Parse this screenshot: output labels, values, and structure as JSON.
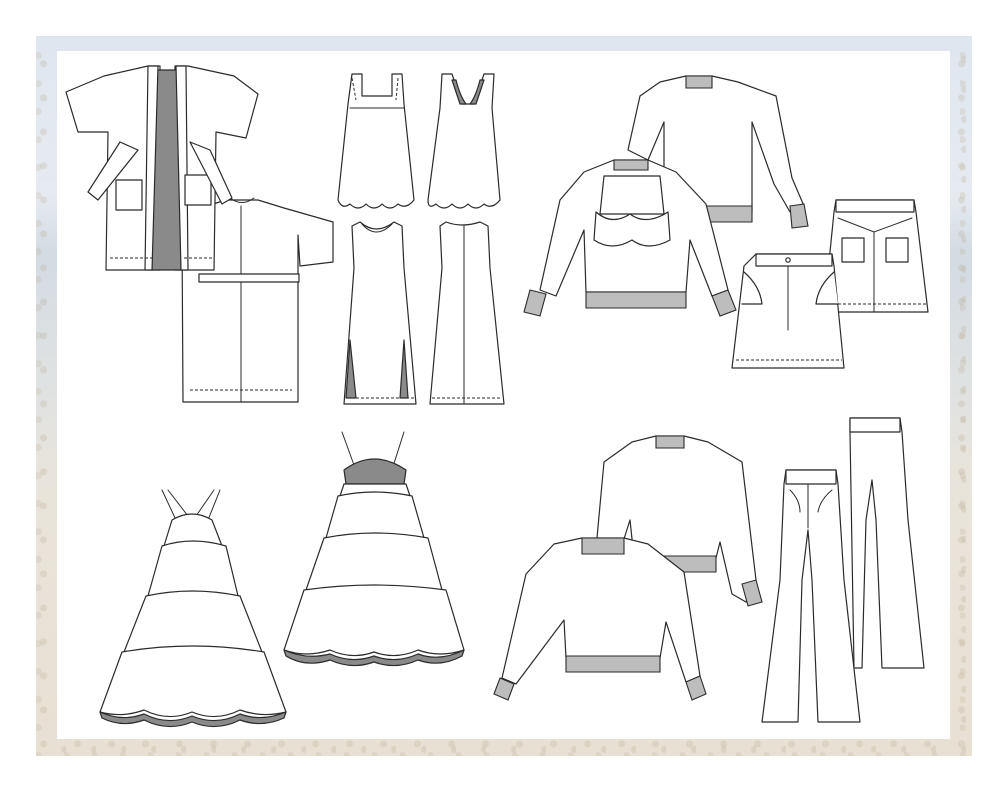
{
  "palette": {
    "outline": "#2b2b2b",
    "lining_gray": "#8a8a8a",
    "rib_gray": "#bdbdbd",
    "sheet": "#ffffff",
    "background_photo": "#dfe6ef"
  },
  "garments": [
    "robe-front-icon",
    "robe-back-icon",
    "lace-strap-top-front-icon",
    "lace-strap-top-back-icon",
    "sleeveless-maxi-dress-front-icon",
    "sleeveless-maxi-dress-back-icon",
    "ruffle-bib-sweatshirt-back-icon",
    "ruffle-bib-sweatshirt-front-icon",
    "denim-skirt-back-icon",
    "denim-skirt-front-icon",
    "tiered-dress-front-icon",
    "tiered-dress-back-icon",
    "sweatshirt-back-icon",
    "sweatshirt-front-icon",
    "flare-pants-back-icon",
    "flare-pants-front-icon"
  ]
}
